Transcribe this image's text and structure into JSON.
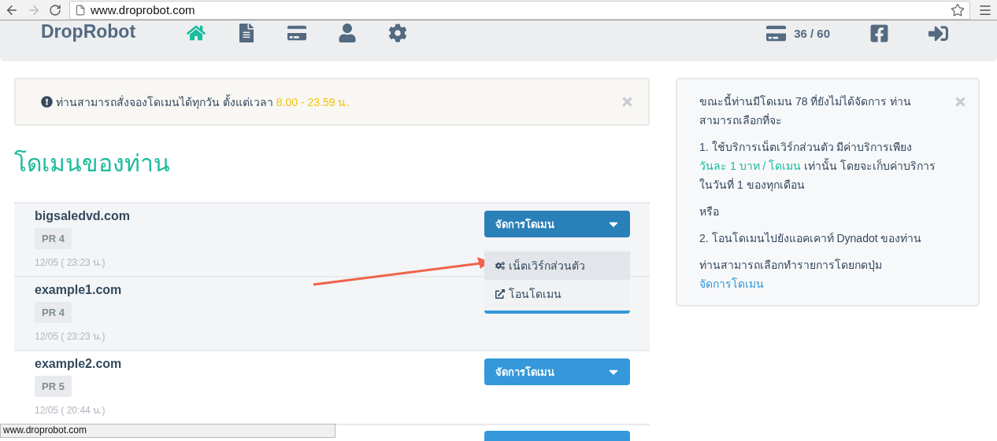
{
  "browser": {
    "url": "www.droprobot.com",
    "back_disabled": false,
    "forward_disabled": true
  },
  "nav": {
    "logo": "DropRobot",
    "items": [
      {
        "kind": "home",
        "selected": true
      },
      {
        "kind": "list",
        "selected": false
      },
      {
        "kind": "card",
        "selected": false
      },
      {
        "kind": "user",
        "selected": false
      },
      {
        "kind": "settings",
        "selected": false
      }
    ],
    "credits": "36 / 60"
  },
  "alert": {
    "text": "ท่านสามารถสั่งจองโดเมนได้ทุกวัน ตั้งแต่เวลา",
    "highlight": "8.00 - 23.59 น."
  },
  "heading": "โดเมนของท่าน",
  "rows": [
    {
      "domain": "bigsaledvd.com",
      "badge": "PR 4",
      "date": "12/05 ( 23:23 น.)",
      "highlighted": true,
      "button": "จัดการโดเมน",
      "open": true
    },
    {
      "domain": "example1.com",
      "badge": "PR 4",
      "date": "12/05 ( 23:23 น.)",
      "highlighted": true
    },
    {
      "domain": "example2.com",
      "badge": "PR 5",
      "date": "12/05 ( 20:44 น.)",
      "highlighted": false,
      "button": "จัดการโดเมน",
      "open": false
    }
  ],
  "more_rows": true,
  "menu": [
    {
      "kind": "network",
      "label": "เน็ตเวิร์กส่วนตัว",
      "selected": true
    },
    {
      "kind": "transfer",
      "label": "โอนโดเมน",
      "selected": false
    }
  ],
  "info": {
    "intro": "ขณะนี้ท่านมีโดเมน 78 ที่ยังไม่ได้จัดการ ท่านสามารถเลือกที่จะ",
    "option1_before": "1. ใช้บริการเน็ตเวิร์กส่วนตัว มีค่าบริการเพียง",
    "option1_price": "วันละ 1 บาท / โดเมน",
    "option1_after": "เท่านั้น โดยจะเก็บค่าบริการในวันที่ 1 ของทุกเดือน",
    "or": "หรือ",
    "option2": "2. โอนโดเมนไปยังแอคเคาท์ Dynadot ของท่าน",
    "action_text": "ท่านสามารถเลือกทำรายการโดยกดปุ่ม",
    "action_link": "จัดการโดเมน"
  },
  "status_bar": "www.droprobot.com"
}
